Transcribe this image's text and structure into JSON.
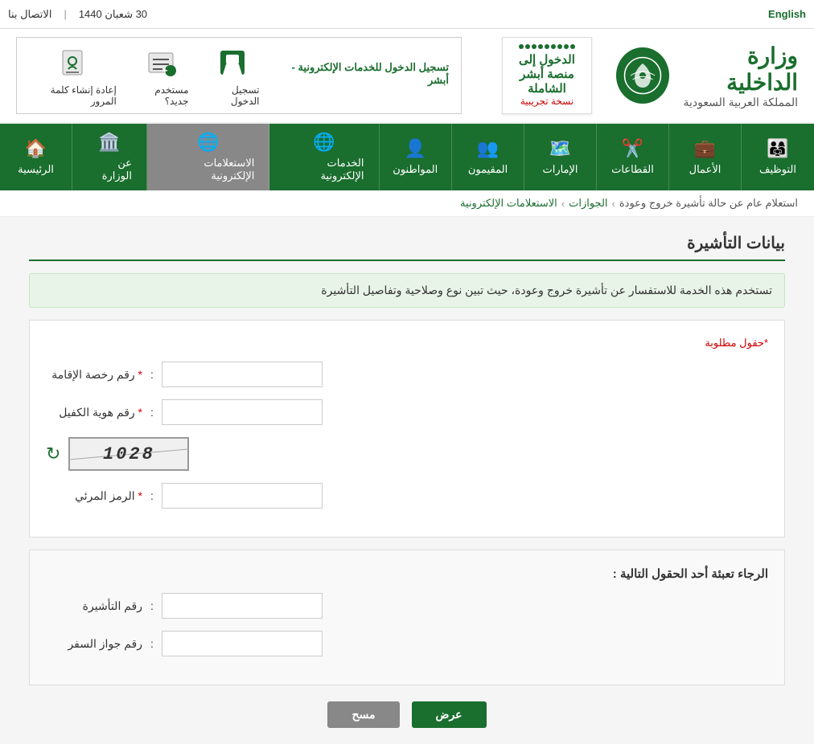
{
  "topbar": {
    "english_label": "English",
    "contact_label": "الاتصال بنا",
    "date_label": "30 شعبان 1440",
    "separator": "|"
  },
  "header": {
    "ministry_name": "وزارة الداخلية",
    "ministry_sub": "المملكة العربية السعودية",
    "absher_title": "الدخول إلى منصة أبشر الشاملة",
    "absher_sub": "نسخة تجريبية"
  },
  "registration": {
    "title": "تسجيل الدخول للخدمات الإلكترونية - أبشر",
    "login_label": "تسجيل الدخول",
    "new_user_label": "مستخدم جديد؟",
    "reset_pass_label": "إعادة إنشاء كلمة المرور"
  },
  "nav": {
    "items": [
      {
        "id": "home",
        "label": "الرئيسية",
        "icon": "🏠"
      },
      {
        "id": "about",
        "label": "عن الوزارة",
        "icon": "🏛️"
      },
      {
        "id": "inquiries",
        "label": "الاستعلامات الإلكترونية",
        "icon": "🌐"
      },
      {
        "id": "eservices",
        "label": "الخدمات الإلكترونية",
        "icon": "🌐"
      },
      {
        "id": "citizens",
        "label": "المواطنون",
        "icon": "👤"
      },
      {
        "id": "residents",
        "label": "المقيمون",
        "icon": "👥"
      },
      {
        "id": "emirates",
        "label": "الإمارات",
        "icon": "🗺️"
      },
      {
        "id": "sectors",
        "label": "القطاعات",
        "icon": "✂️"
      },
      {
        "id": "business",
        "label": "الأعمال",
        "icon": "💼"
      },
      {
        "id": "recruitment",
        "label": "التوظيف",
        "icon": "👨‍👩‍👧"
      }
    ]
  },
  "breadcrumb": {
    "items": [
      {
        "label": "الاستعلامات الإلكترونية",
        "link": true
      },
      {
        "label": "الجوازات",
        "link": true
      },
      {
        "label": "استعلام عام عن حالة تأشيرة خروج وعودة",
        "link": false
      }
    ]
  },
  "page": {
    "title": "بيانات التأشيرة",
    "info_text": "تستخدم هذه الخدمة للاستفسار عن تأشيرة خروج وعودة، حيث تبين نوع وصلاحية وتفاصيل التأشيرة",
    "required_note": "*حقول مطلوبة",
    "iqama_label": "رقم رخصة الإقامة",
    "sponsor_label": "رقم هوية الكفيل",
    "captcha_label": "الرمز المرئي",
    "captcha_value": "1028",
    "optional_title": "الرجاء تعبئة أحد الحقول التالية :",
    "visa_label": "رقم التأشيرة",
    "passport_label": "رقم جواز السفر",
    "required_star": "*"
  },
  "buttons": {
    "show_label": "عرض",
    "clear_label": "مسح"
  }
}
